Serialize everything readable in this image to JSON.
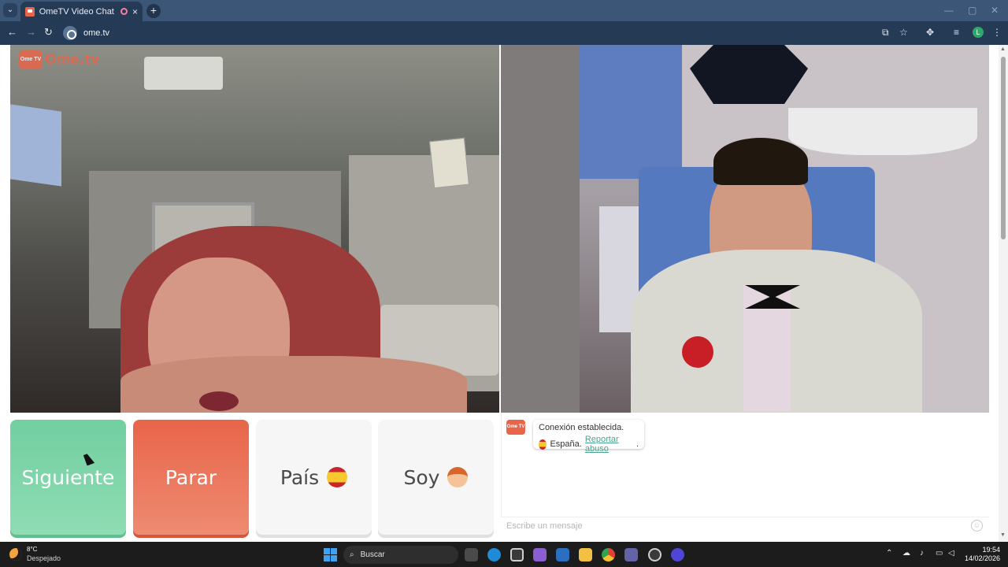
{
  "browser": {
    "tab_title": "OmeTV Video Chat — Ome",
    "tab_close": "×",
    "new_tab": "+",
    "url": "ome.tv",
    "profile_initial": "L"
  },
  "page": {
    "logo": {
      "badge": "Ome TV",
      "brand": "Ome.tv"
    },
    "buttons": {
      "next": "Siguiente",
      "stop": "Parar",
      "country": "País",
      "gender": "Soy"
    },
    "chat": {
      "avatar_badge": "Ome TV",
      "status": "Conexión establecida.",
      "country": "España.",
      "report_link": "Reportar abuso",
      "report_suffix": ".",
      "input_placeholder": "Escribe un mensaje"
    }
  },
  "taskbar": {
    "temperature": "8°C",
    "condition": "Despejado",
    "search": "Buscar",
    "time": "19:54",
    "date": "14/02/2026"
  },
  "colors": {
    "next": "#71cfa0",
    "stop": "#e8654a",
    "brand": "#e8654a",
    "link": "#4aa58c"
  }
}
